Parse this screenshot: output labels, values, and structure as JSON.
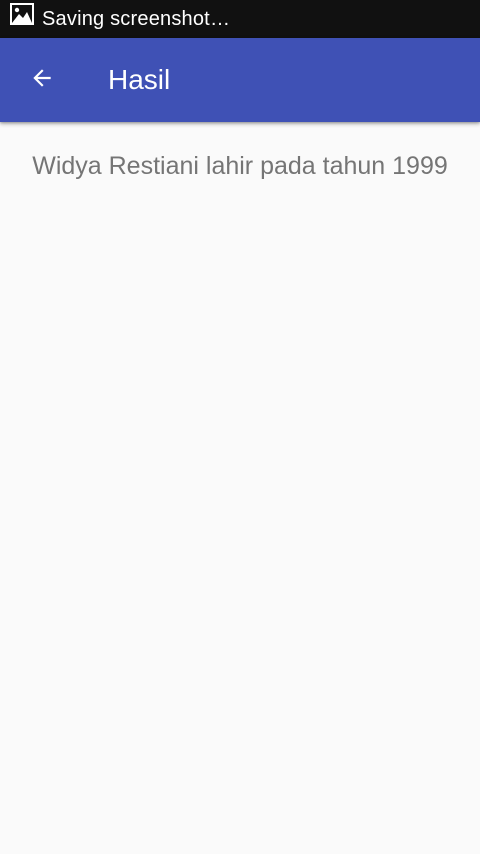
{
  "status_bar": {
    "icon": "image-icon",
    "text": "Saving screenshot…",
    "background": "#111111"
  },
  "app_bar": {
    "back_icon": "arrow-back-icon",
    "title": "Hasil",
    "background": "#3f51b5"
  },
  "content": {
    "result_text": "Widya Restiani lahir pada tahun 1999"
  }
}
